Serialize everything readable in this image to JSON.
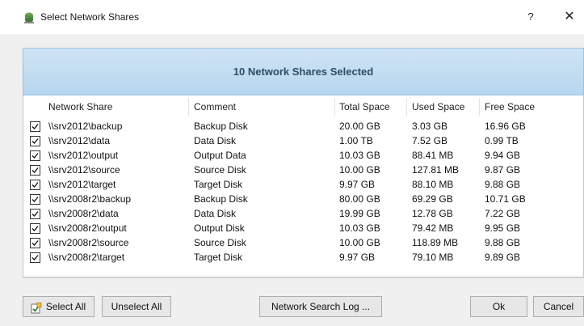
{
  "window": {
    "title": "Select Network Shares",
    "help_label": "?",
    "close_label": "✕"
  },
  "banner": {
    "text": "10 Network Shares Selected"
  },
  "table": {
    "columns": [
      "Network Share",
      "Comment",
      "Total Space",
      "Used Space",
      "Free Space"
    ],
    "rows": [
      {
        "share": "\\\\srv2012\\backup",
        "comment": "Backup Disk",
        "total": "20.00 GB",
        "used": "3.03 GB",
        "free": "16.96 GB",
        "checked": true
      },
      {
        "share": "\\\\srv2012\\data",
        "comment": "Data Disk",
        "total": "1.00 TB",
        "used": "7.52 GB",
        "free": "0.99 TB",
        "checked": true
      },
      {
        "share": "\\\\srv2012\\output",
        "comment": "Output Data",
        "total": "10.03 GB",
        "used": "88.41 MB",
        "free": "9.94 GB",
        "checked": true
      },
      {
        "share": "\\\\srv2012\\source",
        "comment": "Source Disk",
        "total": "10.00 GB",
        "used": "127.81 MB",
        "free": "9.87 GB",
        "checked": true
      },
      {
        "share": "\\\\srv2012\\target",
        "comment": "Target Disk",
        "total": "9.97 GB",
        "used": "88.10 MB",
        "free": "9.88 GB",
        "checked": true
      },
      {
        "share": "\\\\srv2008r2\\backup",
        "comment": "Backup Disk",
        "total": "80.00 GB",
        "used": "69.29 GB",
        "free": "10.71 GB",
        "checked": true
      },
      {
        "share": "\\\\srv2008r2\\data",
        "comment": "Data Disk",
        "total": "19.99 GB",
        "used": "12.78 GB",
        "free": "7.22 GB",
        "checked": true
      },
      {
        "share": "\\\\srv2008r2\\output",
        "comment": "Output Disk",
        "total": "10.03 GB",
        "used": "79.42 MB",
        "free": "9.95 GB",
        "checked": true
      },
      {
        "share": "\\\\srv2008r2\\source",
        "comment": "Source Disk",
        "total": "10.00 GB",
        "used": "118.89 MB",
        "free": "9.88 GB",
        "checked": true
      },
      {
        "share": "\\\\srv2008r2\\target",
        "comment": "Target Disk",
        "total": "9.97 GB",
        "used": "79.10 MB",
        "free": "9.89 GB",
        "checked": true
      }
    ]
  },
  "buttons": {
    "select_all": "Select All",
    "unselect_all": "Unselect All",
    "search_log": "Network Search Log ...",
    "ok": "Ok",
    "cancel": "Cancel"
  },
  "icons": {
    "app": "network-share-icon",
    "select_all": "select-all-icon"
  },
  "colors": {
    "banner_bg": "#c3dcf0",
    "banner_text": "#2d4d66"
  }
}
